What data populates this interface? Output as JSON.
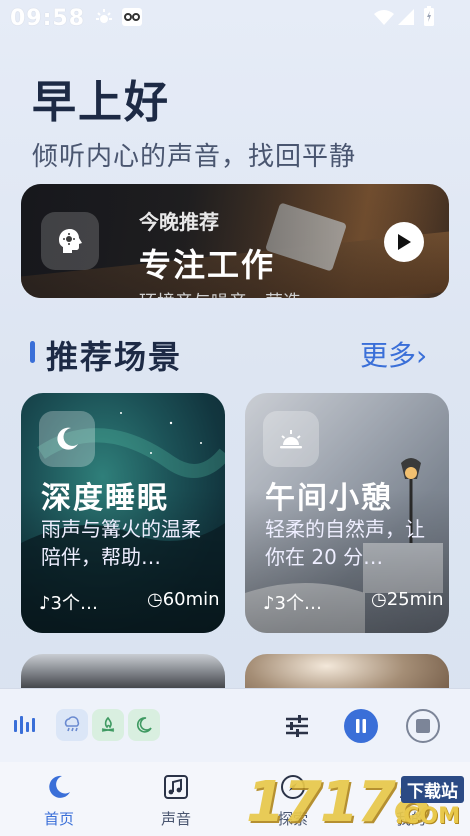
{
  "status": {
    "time": "09:58"
  },
  "header": {
    "greeting": "早上好",
    "subtitle": "倾听内心的声音，找回平静"
  },
  "featured": {
    "kicker": "今晚推荐",
    "title": "专注工作",
    "description": "环境音与噪音，营造"
  },
  "section": {
    "title": "推荐场景",
    "more": "更多",
    "more_chevron": "›"
  },
  "cards": [
    {
      "title": "深度睡眠",
      "description": "雨声与篝火的温柔陪伴，帮助…",
      "tracks": "3个…",
      "duration": "60min",
      "icon": "moon-icon"
    },
    {
      "title": "午间小憩",
      "description": "轻柔的自然声，让你在 20 分…",
      "tracks": "3个…",
      "duration": "25min",
      "icon": "sunrise-icon"
    }
  ],
  "player": {
    "chips": [
      "rain-icon",
      "campfire-icon",
      "moon-icon"
    ]
  },
  "nav": {
    "items": [
      {
        "label": "首页",
        "icon": "moon-icon",
        "active": true
      },
      {
        "label": "声音",
        "icon": "music-note-icon",
        "active": false
      },
      {
        "label": "探索",
        "icon": "compass-icon",
        "active": false
      },
      {
        "label": "我的",
        "icon": "profile-icon",
        "active": false
      }
    ]
  },
  "watermark": {
    "logo": "17178",
    "tag": "下载站",
    "domain": ".COM"
  },
  "colors": {
    "accent": "#3a6fd8",
    "text_dark": "#1d2a45",
    "background": "#e6ecf7"
  }
}
